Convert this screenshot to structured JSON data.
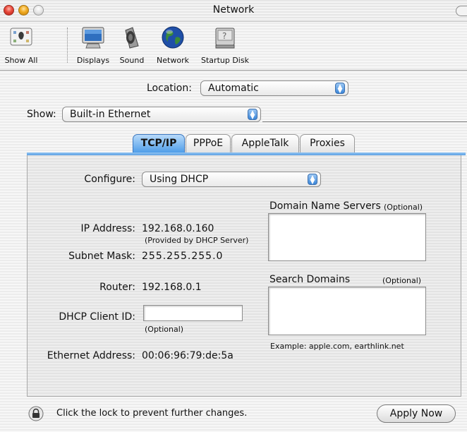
{
  "window": {
    "title": "Network"
  },
  "toolbar": {
    "items": [
      {
        "label": "Show All",
        "icon": "show-all-icon"
      },
      {
        "label": "Displays",
        "icon": "display-icon"
      },
      {
        "label": "Sound",
        "icon": "speaker-icon"
      },
      {
        "label": "Network",
        "icon": "globe-icon"
      },
      {
        "label": "Startup Disk",
        "icon": "disk-icon"
      }
    ]
  },
  "location": {
    "label": "Location:",
    "value": "Automatic"
  },
  "show": {
    "label": "Show:",
    "value": "Built-in Ethernet"
  },
  "tabs": [
    {
      "label": "TCP/IP",
      "active": true
    },
    {
      "label": "PPPoE",
      "active": false
    },
    {
      "label": "AppleTalk",
      "active": false
    },
    {
      "label": "Proxies",
      "active": false
    }
  ],
  "tcpip": {
    "configure": {
      "label": "Configure:",
      "value": "Using DHCP"
    },
    "ip_address": {
      "label": "IP Address:",
      "value": "192.168.0.160",
      "note": "(Provided by DHCP Server)"
    },
    "subnet_mask": {
      "label": "Subnet Mask:",
      "value": "255.255.255.0"
    },
    "router": {
      "label": "Router:",
      "value": "192.168.0.1"
    },
    "dhcp_client_id": {
      "label": "DHCP Client ID:",
      "value": "",
      "note": "(Optional)"
    },
    "ethernet_address": {
      "label": "Ethernet Address:",
      "value": "00:06:96:79:de:5a"
    },
    "dns": {
      "label": "Domain Name Servers",
      "optional": "(Optional)",
      "value": ""
    },
    "search_domains": {
      "label": "Search Domains",
      "optional": "(Optional)",
      "value": "",
      "example": "Example: apple.com, earthlink.net"
    }
  },
  "footer": {
    "lock_text": "Click the lock to prevent further changes.",
    "apply_label": "Apply Now"
  },
  "colors": {
    "accent": "#4b9be8",
    "close": "#e8483a",
    "minimize": "#f0aa20"
  }
}
